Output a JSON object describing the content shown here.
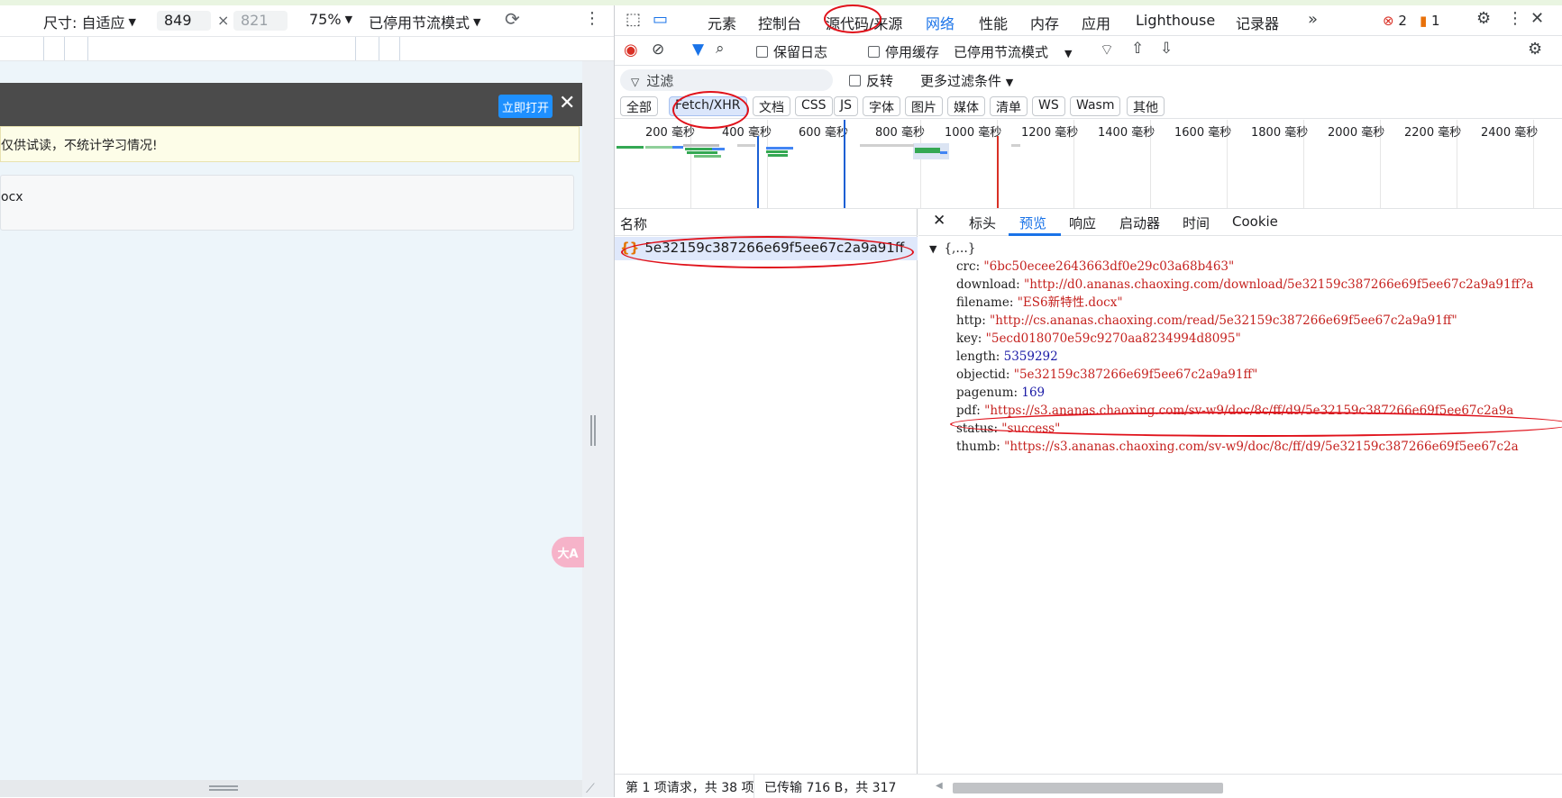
{
  "device_toolbar": {
    "size_label": "尺寸: 自适应",
    "width": "849",
    "height": "821",
    "zoom": "75%",
    "throttle": "已停用节流模式"
  },
  "page": {
    "open_button": "立即打开",
    "notice": "仅供试读，不统计学习情况!",
    "file_name_fragment": "ocx",
    "float_button": "大A"
  },
  "devtools": {
    "tabs": [
      "元素",
      "控制台",
      "源代码/来源",
      "网络",
      "性能",
      "内存",
      "应用",
      "Lighthouse",
      "记录器"
    ],
    "active_tab": "网络",
    "error_count": "2",
    "warning_count": "1",
    "network_toolbar": {
      "preserve_log": "保留日志",
      "disable_cache": "停用缓存",
      "throttle": "已停用节流模式"
    },
    "filter": {
      "placeholder": "过滤",
      "invert": "反转",
      "more": "更多过滤条件"
    },
    "type_filters": [
      "全部",
      "Fetch/XHR",
      "文档",
      "CSS",
      "JS",
      "字体",
      "图片",
      "媒体",
      "清单",
      "WS",
      "Wasm",
      "其他"
    ],
    "active_type_filter": "Fetch/XHR",
    "timeline_ticks": [
      "200 毫秒",
      "400 毫秒",
      "600 毫秒",
      "800 毫秒",
      "1000 毫秒",
      "1200 毫秒",
      "1400 毫秒",
      "1600 毫秒",
      "1800 毫秒",
      "2000 毫秒",
      "2200 毫秒",
      "2400 毫秒"
    ],
    "list_header": "名称",
    "request_name": "5e32159c387266e69f5ee67c2a9a91ff",
    "detail_tabs": [
      "标头",
      "预览",
      "响应",
      "启动器",
      "时间",
      "Cookie"
    ],
    "active_detail_tab": "预览",
    "json_root": "{,…}",
    "json": [
      {
        "key": "crc",
        "value": "\"6bc50ecee2643663df0e29c03a68b463\"",
        "type": "string"
      },
      {
        "key": "download",
        "value": "\"http://d0.ananas.chaoxing.com/download/5e32159c387266e69f5ee67c2a9a91ff?a",
        "type": "string"
      },
      {
        "key": "filename",
        "value": "\"ES6新特性.docx\"",
        "type": "string"
      },
      {
        "key": "http",
        "value": "\"http://cs.ananas.chaoxing.com/read/5e32159c387266e69f5ee67c2a9a91ff\"",
        "type": "string"
      },
      {
        "key": "key",
        "value": "\"5ecd018070e59c9270aa8234994d8095\"",
        "type": "string"
      },
      {
        "key": "length",
        "value": "5359292",
        "type": "number"
      },
      {
        "key": "objectid",
        "value": "\"5e32159c387266e69f5ee67c2a9a91ff\"",
        "type": "string"
      },
      {
        "key": "pagenum",
        "value": "169",
        "type": "number"
      },
      {
        "key": "pdf",
        "value": "\"https://s3.ananas.chaoxing.com/sv-w9/doc/8c/ff/d9/5e32159c387266e69f5ee67c2a9a",
        "type": "string"
      },
      {
        "key": "status",
        "value": "\"success\"",
        "type": "string"
      },
      {
        "key": "thumb",
        "value": "\"https://s3.ananas.chaoxing.com/sv-w9/doc/8c/ff/d9/5e32159c387266e69f5ee67c2a",
        "type": "string"
      }
    ],
    "status_requests": "第 1 项请求，共 38 项",
    "status_transfer": "已传输 716 B，共 317"
  },
  "colors": {
    "annotation_red": "#e0121b",
    "accent_blue": "#1a73e8"
  }
}
